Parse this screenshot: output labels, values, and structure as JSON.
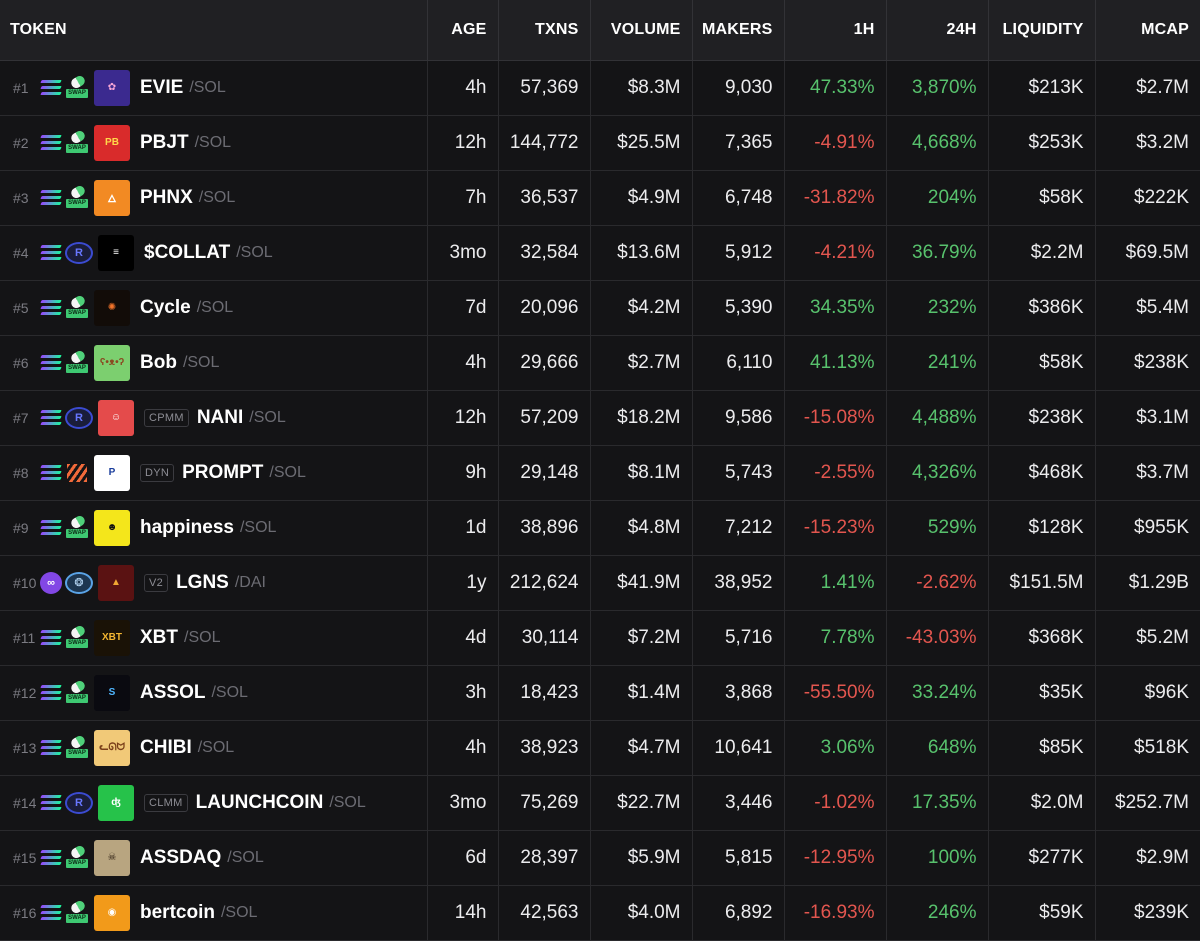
{
  "colors": {
    "positive": "#58c26d",
    "negative": "#e3564f",
    "background": "#141416",
    "header": "#202023"
  },
  "headers": {
    "token": "TOKEN",
    "age": "AGE",
    "txns": "TXNS",
    "volume": "VOLUME",
    "makers": "MAKERS",
    "h1": "1H",
    "h24": "24H",
    "liquidity": "LIQUIDITY",
    "mcap": "MCAP"
  },
  "rows": [
    {
      "rank": "#1",
      "chain": "solana-icon",
      "dex": "pumpswap-icon",
      "tag": "",
      "symbol": "EVIE",
      "quote": "/SOL",
      "age": "4h",
      "txns": "57,369",
      "volume": "$8.3M",
      "makers": "9,030",
      "h1": "47.33%",
      "h24": "3,870%",
      "liquidity": "$213K",
      "mcap": "$2.7M"
    },
    {
      "rank": "#2",
      "chain": "solana-icon",
      "dex": "pumpswap-icon",
      "tag": "",
      "symbol": "PBJT",
      "quote": "/SOL",
      "age": "12h",
      "txns": "144,772",
      "volume": "$25.5M",
      "makers": "7,365",
      "h1": "-4.91%",
      "h24": "4,668%",
      "liquidity": "$253K",
      "mcap": "$3.2M"
    },
    {
      "rank": "#3",
      "chain": "solana-icon",
      "dex": "pumpswap-icon",
      "tag": "",
      "symbol": "PHNX",
      "quote": "/SOL",
      "age": "7h",
      "txns": "36,537",
      "volume": "$4.9M",
      "makers": "6,748",
      "h1": "-31.82%",
      "h24": "204%",
      "liquidity": "$58K",
      "mcap": "$222K"
    },
    {
      "rank": "#4",
      "chain": "solana-icon",
      "dex": "raydium-icon",
      "tag": "",
      "symbol": "$COLLAT",
      "quote": "/SOL",
      "age": "3mo",
      "txns": "32,584",
      "volume": "$13.6M",
      "makers": "5,912",
      "h1": "-4.21%",
      "h24": "36.79%",
      "liquidity": "$2.2M",
      "mcap": "$69.5M"
    },
    {
      "rank": "#5",
      "chain": "solana-icon",
      "dex": "pumpswap-icon",
      "tag": "",
      "symbol": "Cycle",
      "quote": "/SOL",
      "age": "7d",
      "txns": "20,096",
      "volume": "$4.2M",
      "makers": "5,390",
      "h1": "34.35%",
      "h24": "232%",
      "liquidity": "$386K",
      "mcap": "$5.4M"
    },
    {
      "rank": "#6",
      "chain": "solana-icon",
      "dex": "pumpswap-icon",
      "tag": "",
      "symbol": "Bob",
      "quote": "/SOL",
      "age": "4h",
      "txns": "29,666",
      "volume": "$2.7M",
      "makers": "6,110",
      "h1": "41.13%",
      "h24": "241%",
      "liquidity": "$58K",
      "mcap": "$238K"
    },
    {
      "rank": "#7",
      "chain": "solana-icon",
      "dex": "raydium-icon",
      "tag": "CPMM",
      "symbol": "NANI",
      "quote": "/SOL",
      "age": "12h",
      "txns": "57,209",
      "volume": "$18.2M",
      "makers": "9,586",
      "h1": "-15.08%",
      "h24": "4,488%",
      "liquidity": "$238K",
      "mcap": "$3.1M"
    },
    {
      "rank": "#8",
      "chain": "solana-icon",
      "dex": "meteora-icon",
      "tag": "DYN",
      "symbol": "PROMPT",
      "quote": "/SOL",
      "age": "9h",
      "txns": "29,148",
      "volume": "$8.1M",
      "makers": "5,743",
      "h1": "-2.55%",
      "h24": "4,326%",
      "liquidity": "$468K",
      "mcap": "$3.7M"
    },
    {
      "rank": "#9",
      "chain": "solana-icon",
      "dex": "pumpswap-icon",
      "tag": "",
      "symbol": "happiness",
      "quote": "/SOL",
      "age": "1d",
      "txns": "38,896",
      "volume": "$4.8M",
      "makers": "7,212",
      "h1": "-15.23%",
      "h24": "529%",
      "liquidity": "$128K",
      "mcap": "$955K"
    },
    {
      "rank": "#10",
      "chain": "polygon-icon",
      "dex": "uniswap-icon",
      "tag": "V2",
      "symbol": "LGNS",
      "quote": "/DAI",
      "age": "1y",
      "txns": "212,624",
      "volume": "$41.9M",
      "makers": "38,952",
      "h1": "1.41%",
      "h24": "-2.62%",
      "liquidity": "$151.5M",
      "mcap": "$1.29B"
    },
    {
      "rank": "#11",
      "chain": "solana-icon",
      "dex": "pumpswap-icon",
      "tag": "",
      "symbol": "XBT",
      "quote": "/SOL",
      "age": "4d",
      "txns": "30,114",
      "volume": "$7.2M",
      "makers": "5,716",
      "h1": "7.78%",
      "h24": "-43.03%",
      "liquidity": "$368K",
      "mcap": "$5.2M"
    },
    {
      "rank": "#12",
      "chain": "solana-icon",
      "dex": "pumpswap-icon",
      "tag": "",
      "symbol": "ASSOL",
      "quote": "/SOL",
      "age": "3h",
      "txns": "18,423",
      "volume": "$1.4M",
      "makers": "3,868",
      "h1": "-55.50%",
      "h24": "33.24%",
      "liquidity": "$35K",
      "mcap": "$96K"
    },
    {
      "rank": "#13",
      "chain": "solana-icon",
      "dex": "pumpswap-icon",
      "tag": "",
      "symbol": "CHIBI",
      "quote": "/SOL",
      "age": "4h",
      "txns": "38,923",
      "volume": "$4.7M",
      "makers": "10,641",
      "h1": "3.06%",
      "h24": "648%",
      "liquidity": "$85K",
      "mcap": "$518K"
    },
    {
      "rank": "#14",
      "chain": "solana-icon",
      "dex": "raydium-icon",
      "tag": "CLMM",
      "symbol": "LAUNCHCOIN",
      "quote": "/SOL",
      "age": "3mo",
      "txns": "75,269",
      "volume": "$22.7M",
      "makers": "3,446",
      "h1": "-1.02%",
      "h24": "17.35%",
      "liquidity": "$2.0M",
      "mcap": "$252.7M"
    },
    {
      "rank": "#15",
      "chain": "solana-icon",
      "dex": "pumpswap-icon",
      "tag": "",
      "symbol": "ASSDAQ",
      "quote": "/SOL",
      "age": "6d",
      "txns": "28,397",
      "volume": "$5.9M",
      "makers": "5,815",
      "h1": "-12.95%",
      "h24": "100%",
      "liquidity": "$277K",
      "mcap": "$2.9M"
    },
    {
      "rank": "#16",
      "chain": "solana-icon",
      "dex": "pumpswap-icon",
      "tag": "",
      "symbol": "bertcoin",
      "quote": "/SOL",
      "age": "14h",
      "txns": "42,563",
      "volume": "$4.0M",
      "makers": "6,892",
      "h1": "-16.93%",
      "h24": "246%",
      "liquidity": "$59K",
      "mcap": "$239K"
    }
  ],
  "avatars": [
    {
      "icon": "pink-character-avatar",
      "bg": "#3b2a8f",
      "fg": "#f7a6d6",
      "glyph": "✿"
    },
    {
      "icon": "peanut-butter-avatar",
      "bg": "#d92b2b",
      "fg": "#ffd84a",
      "glyph": "PB"
    },
    {
      "icon": "phoenix-avatar",
      "bg": "#f28a23",
      "fg": "#ffffff",
      "glyph": "🜂"
    },
    {
      "icon": "striped-sphere-avatar",
      "bg": "#000000",
      "fg": "#ffffff",
      "glyph": "≡"
    },
    {
      "icon": "orange-flower-avatar",
      "bg": "#120c08",
      "fg": "#f2742a",
      "glyph": "✺"
    },
    {
      "icon": "bob-bear-avatar",
      "bg": "#7ccf6f",
      "fg": "#8a4b22",
      "glyph": "ʕ•ᴥ•ʔ"
    },
    {
      "icon": "pixel-character-avatar",
      "bg": "#e44b4b",
      "fg": "#ffffff",
      "glyph": "☺"
    },
    {
      "icon": "prompt-logo-avatar",
      "bg": "#ffffff",
      "fg": "#1a3d9c",
      "glyph": "P"
    },
    {
      "icon": "smiley-face-avatar",
      "bg": "#f4e61b",
      "fg": "#111111",
      "glyph": "☻"
    },
    {
      "icon": "lgns-triangle-avatar",
      "bg": "#5a1212",
      "fg": "#f0a733",
      "glyph": "▲"
    },
    {
      "icon": "xbt-logo-avatar",
      "bg": "#1a1206",
      "fg": "#f2b531",
      "glyph": "XBT"
    },
    {
      "icon": "assol-s-logo-avatar",
      "bg": "#0a0a10",
      "fg": "#4fb6ff",
      "glyph": "S"
    },
    {
      "icon": "chibi-character-avatar",
      "bg": "#f1c978",
      "fg": "#7a3f1a",
      "glyph": "ᓚᘏᗢ"
    },
    {
      "icon": "launchcoin-logo-avatar",
      "bg": "#26c24a",
      "fg": "#ffffff",
      "glyph": "ʤ"
    },
    {
      "icon": "assdaq-character-avatar",
      "bg": "#b8a580",
      "fg": "#2a1c10",
      "glyph": "☠"
    },
    {
      "icon": "bertcoin-logo-avatar",
      "bg": "#f29a1a",
      "fg": "#ffffff",
      "glyph": "◉"
    }
  ]
}
